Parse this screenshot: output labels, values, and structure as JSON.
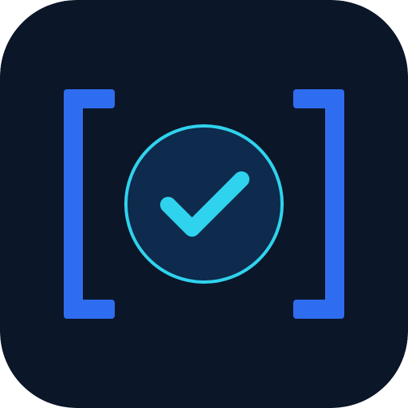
{
  "app_icon": {
    "icon_name": "bracketed-check-circle-icon",
    "colors": {
      "background": "#0b1628",
      "bracket": "#2f6df0",
      "circle_fill": "#0e2a4c",
      "circle_stroke": "#2fd3ee",
      "check": "#2fd3ee"
    }
  }
}
